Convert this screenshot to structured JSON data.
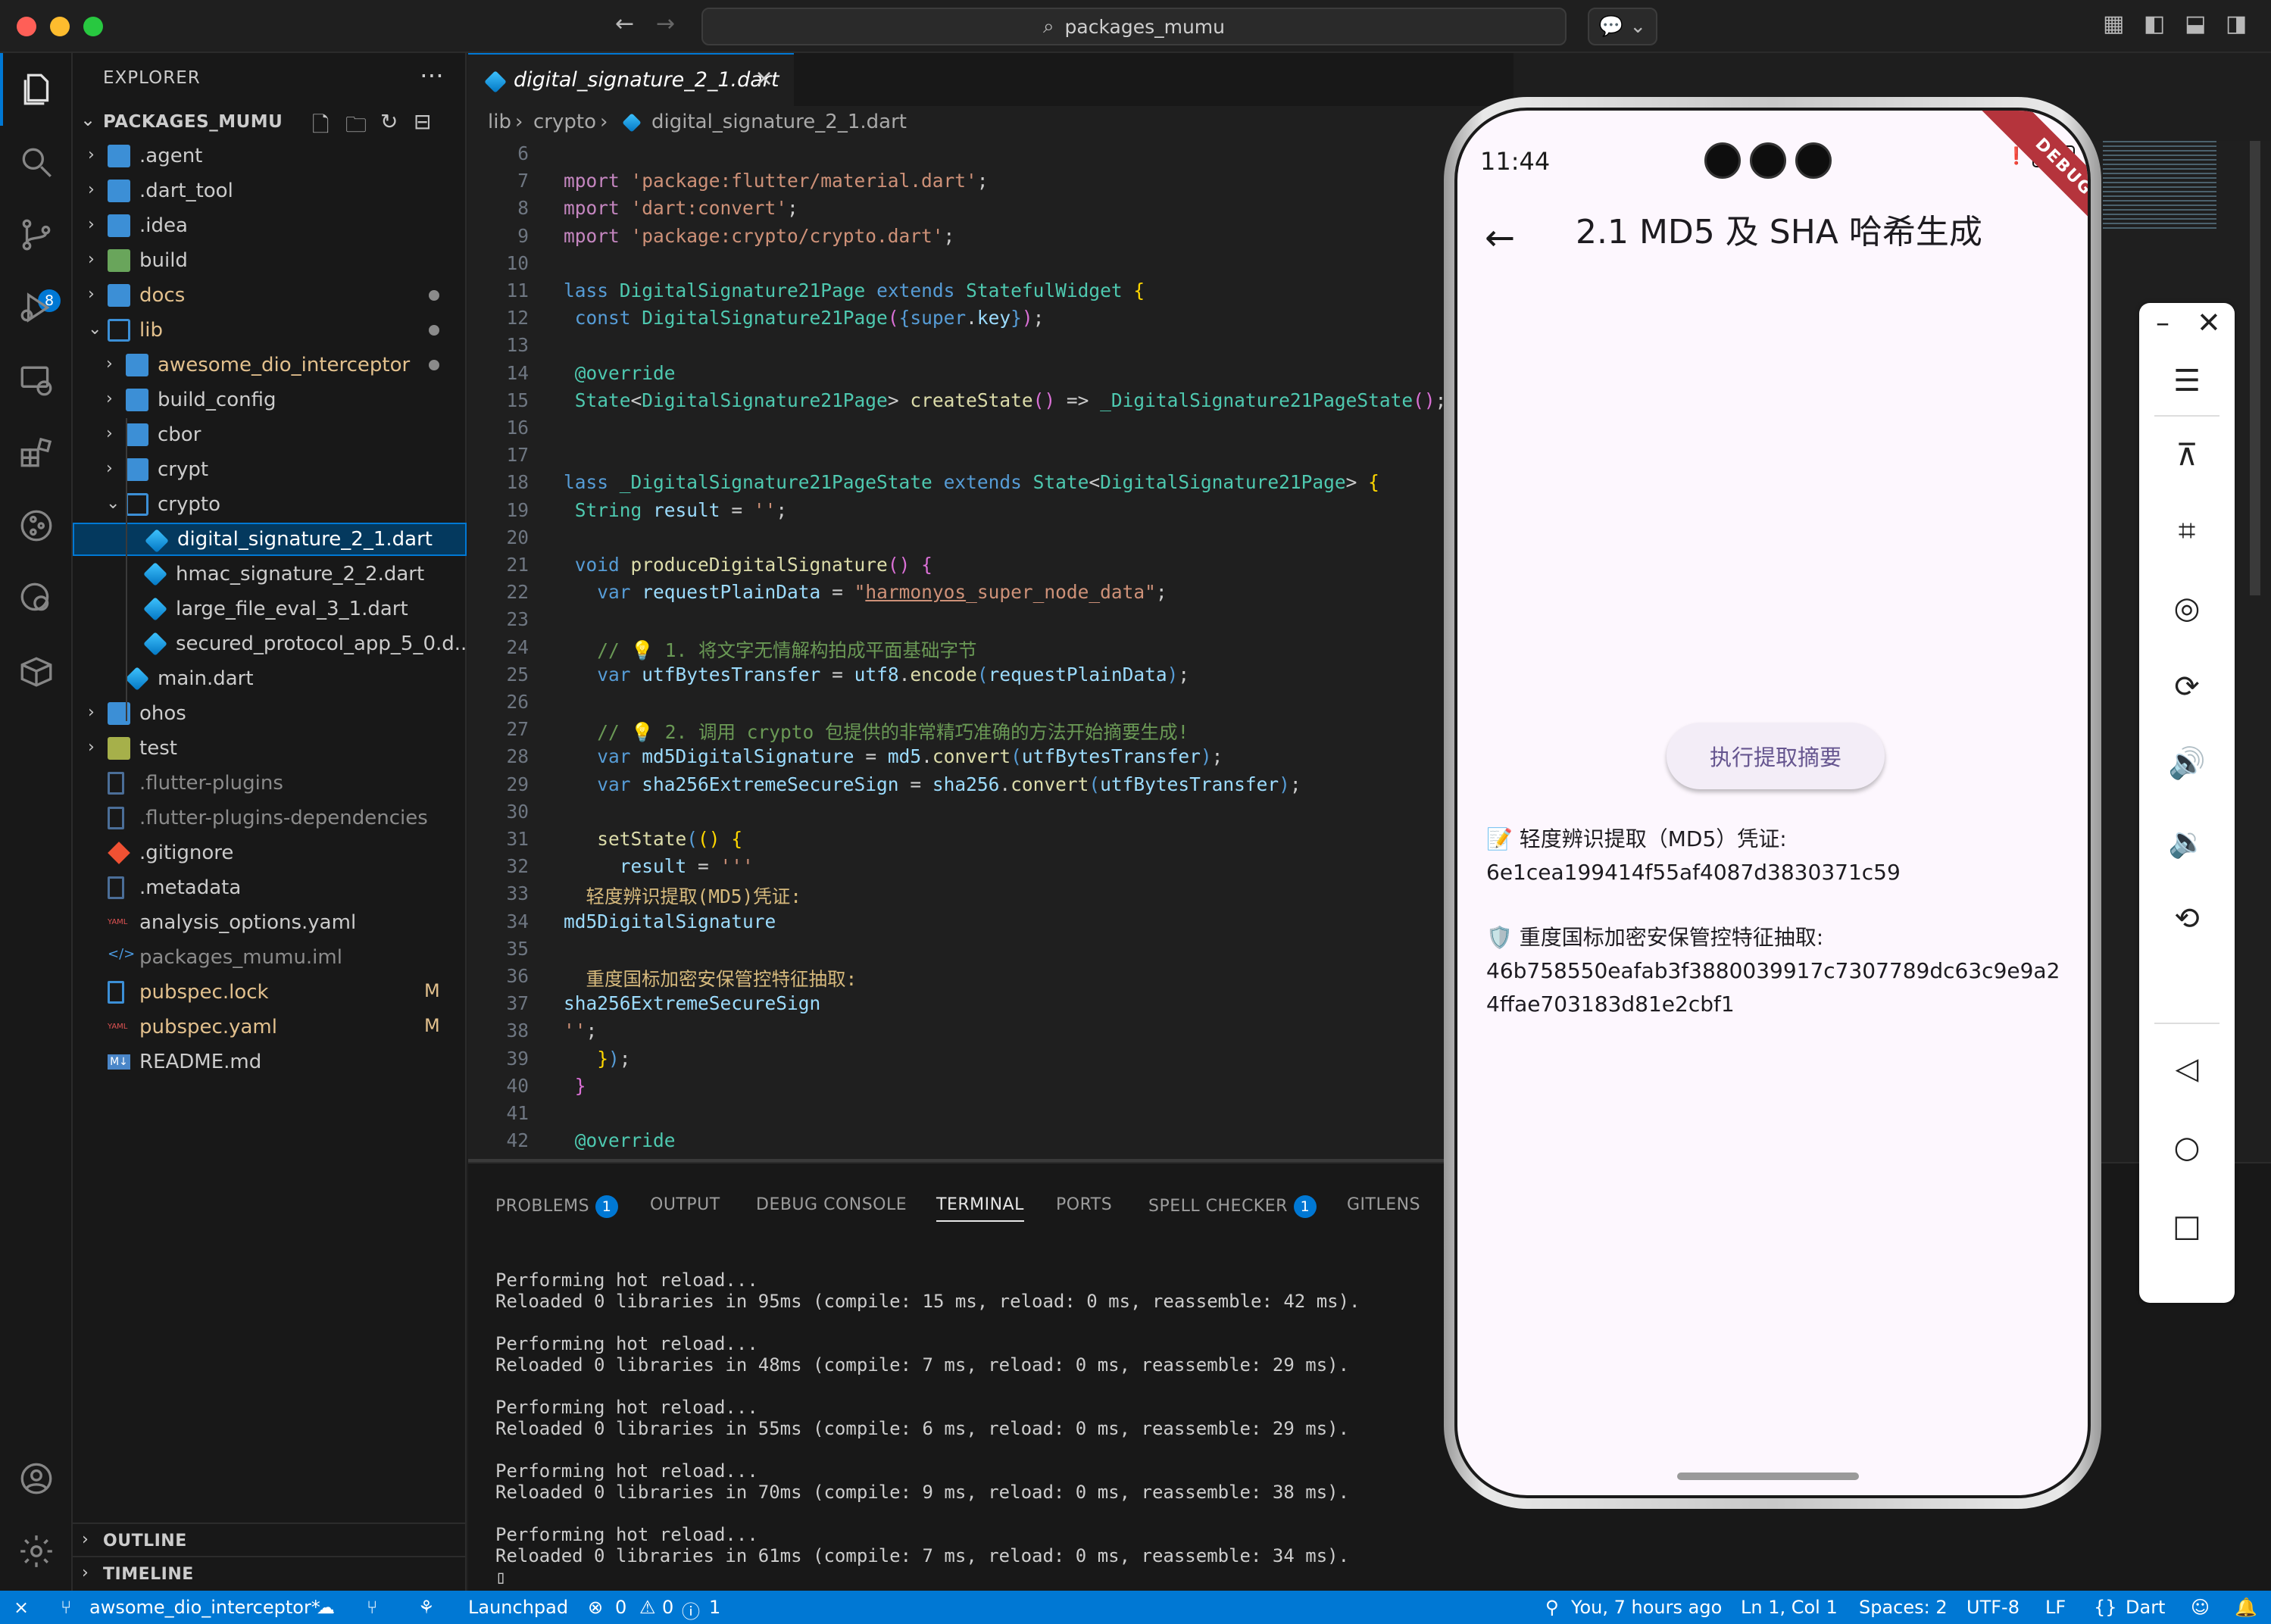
{
  "titlebar": {
    "command_center": "packages_mumu"
  },
  "activity": {
    "scm_badge": "8"
  },
  "explorer": {
    "title": "EXPLORER",
    "project": "PACKAGES_MUMU",
    "tree": [
      {
        "label": ".agent",
        "depth": 0,
        "kind": "folder",
        "open": false
      },
      {
        "label": ".dart_tool",
        "depth": 0,
        "kind": "folder",
        "open": false
      },
      {
        "label": ".idea",
        "depth": 0,
        "kind": "folder",
        "open": false
      },
      {
        "label": "build",
        "depth": 0,
        "kind": "folder-special",
        "open": false
      },
      {
        "label": "docs",
        "depth": 0,
        "kind": "folder",
        "open": false,
        "dot": true,
        "modified": true
      },
      {
        "label": "lib",
        "depth": 0,
        "kind": "folder",
        "open": true,
        "dot": true,
        "modified": true
      },
      {
        "label": "awesome_dio_interceptor",
        "depth": 1,
        "kind": "folder",
        "open": false,
        "dot": true,
        "modified": true
      },
      {
        "label": "build_config",
        "depth": 1,
        "kind": "folder",
        "open": false
      },
      {
        "label": "cbor",
        "depth": 1,
        "kind": "folder",
        "open": false
      },
      {
        "label": "crypt",
        "depth": 1,
        "kind": "folder",
        "open": false
      },
      {
        "label": "crypto",
        "depth": 1,
        "kind": "folder",
        "open": true
      },
      {
        "label": "digital_signature_2_1.dart",
        "depth": 2,
        "kind": "dart",
        "selected": true
      },
      {
        "label": "hmac_signature_2_2.dart",
        "depth": 2,
        "kind": "dart"
      },
      {
        "label": "large_file_eval_3_1.dart",
        "depth": 2,
        "kind": "dart"
      },
      {
        "label": "secured_protocol_app_5_0.d...",
        "depth": 2,
        "kind": "dart"
      },
      {
        "label": "main.dart",
        "depth": 1,
        "kind": "dart"
      },
      {
        "label": "ohos",
        "depth": 0,
        "kind": "folder",
        "open": false
      },
      {
        "label": "test",
        "depth": 0,
        "kind": "folder-test",
        "open": false
      },
      {
        "label": ".flutter-plugins",
        "depth": 0,
        "kind": "file",
        "faded": true
      },
      {
        "label": ".flutter-plugins-dependencies",
        "depth": 0,
        "kind": "file",
        "faded": true
      },
      {
        "label": ".gitignore",
        "depth": 0,
        "kind": "git"
      },
      {
        "label": ".metadata",
        "depth": 0,
        "kind": "file"
      },
      {
        "label": "analysis_options.yaml",
        "depth": 0,
        "kind": "yaml"
      },
      {
        "label": "packages_mumu.iml",
        "depth": 0,
        "kind": "xml",
        "faded": true
      },
      {
        "label": "pubspec.lock",
        "depth": 0,
        "kind": "file-blue",
        "modified": true,
        "badge": "M"
      },
      {
        "label": "pubspec.yaml",
        "depth": 0,
        "kind": "yaml",
        "modified": true,
        "badge": "M"
      },
      {
        "label": "README.md",
        "depth": 0,
        "kind": "md"
      }
    ],
    "outline": "OUTLINE",
    "timeline": "TIMELINE"
  },
  "editor": {
    "tab": "digital_signature_2_1.dart",
    "breadcrumb": [
      "lib",
      "crypto",
      "digital_signature_2_1.dart"
    ],
    "lines": [
      {
        "n": "6",
        "html": ""
      },
      {
        "n": "7",
        "html": "<span class='kw'>mport</span> <span class='s'>'package:flutter/material.dart'</span>;"
      },
      {
        "n": "8",
        "html": "<span class='kw'>mport</span> <span class='s'>'dart:convert'</span>;"
      },
      {
        "n": "9",
        "html": "<span class='kw'>mport</span> <span class='s'>'package:crypto/crypto.dart'</span>;"
      },
      {
        "n": "10",
        "html": ""
      },
      {
        "n": "11",
        "html": "<span class='k'>lass</span> <span class='t'>DigitalSignature21Page</span> <span class='k'>extends</span> <span class='t'>StatefulWidget</span> <span class='y'>{</span>"
      },
      {
        "n": "12",
        "html": " <span class='k'>const</span> <span class='t'>DigitalSignature21Page</span><span class='p'>(</span><span class='k'>{super</span>.<span class='v'>key</span><span class='k'>}</span><span class='p'>)</span>;"
      },
      {
        "n": "13",
        "html": ""
      },
      {
        "n": "14",
        "html": " <span class='t'>@override</span>"
      },
      {
        "n": "15",
        "html": " <span class='t'>State</span>&lt;<span class='t'>DigitalSignature21Page</span>&gt; <span class='f'>createState</span><span class='p'>()</span> =&gt; <span class='t'>_DigitalSignature21PageState</span><span class='p'>()</span>;"
      },
      {
        "n": "16",
        "html": ""
      },
      {
        "n": "17",
        "html": ""
      },
      {
        "n": "18",
        "html": "<span class='k'>lass</span> <span class='t'>_DigitalSignature21PageState</span> <span class='k'>extends</span> <span class='t'>State</span>&lt;<span class='t'>DigitalSignature21Page</span>&gt; <span class='y'>{</span>"
      },
      {
        "n": "19",
        "html": " <span class='t'>String</span> <span class='v'>result</span> = <span class='s'>''</span>;"
      },
      {
        "n": "20",
        "html": ""
      },
      {
        "n": "21",
        "html": " <span class='k'>void</span> <span class='f'>produceDigitalSignature</span><span class='p'>()</span> <span class='p'>{</span>"
      },
      {
        "n": "22",
        "html": "   <span class='k'>var</span> <span class='v'>requestPlainData</span> = <span class='s'>\"<u>harmonyos</u>_super_node_data\"</span>;"
      },
      {
        "n": "23",
        "html": ""
      },
      {
        "n": "24",
        "html": "   <span class='c'>// 💡 1. 将文字无情解构拍成平面基础字节</span>"
      },
      {
        "n": "25",
        "html": "   <span class='k'>var</span> <span class='v'>utfBytesTransfer</span> = <span class='v'>utf8</span>.<span class='f'>encode</span><span class='k'>(</span><span class='v'>requestPlainData</span><span class='k'>)</span>;"
      },
      {
        "n": "26",
        "html": ""
      },
      {
        "n": "27",
        "html": "   <span class='c'>// 💡 2. 调用 crypto 包提供的非常精巧准确的方法开始摘要生成!</span>"
      },
      {
        "n": "28",
        "html": "   <span class='k'>var</span> <span class='v'>md5DigitalSignature</span> = <span class='v'>md5</span>.<span class='f'>convert</span><span class='k'>(</span><span class='v'>utfBytesTransfer</span><span class='k'>)</span>;"
      },
      {
        "n": "29",
        "html": "   <span class='k'>var</span> <span class='v'>sha256ExtremeSecureSign</span> = <span class='v'>sha256</span>.<span class='f'>convert</span><span class='k'>(</span><span class='v'>utfBytesTransfer</span><span class='k'>)</span>;"
      },
      {
        "n": "30",
        "html": ""
      },
      {
        "n": "31",
        "html": "   <span class='f'>setState</span><span class='k'>(</span><span class='y'>()</span> <span class='y'>{</span>"
      },
      {
        "n": "32",
        "html": "     <span class='v'>result</span> = <span class='s'>'''</span>"
      },
      {
        "n": "33",
        "html": "  <span class='o'>轻度辨识提取(MD5)凭证:</span>"
      },
      {
        "n": "34",
        "html": "<span class='v'>md5DigitalSignature</span>"
      },
      {
        "n": "35",
        "html": ""
      },
      {
        "n": "36",
        "html": "  <span class='o'>重度国标加密安保管控特征抽取:</span>"
      },
      {
        "n": "37",
        "html": "<span class='v'>sha256ExtremeSecureSign</span>"
      },
      {
        "n": "38",
        "html": "<span class='s'>''</span>;"
      },
      {
        "n": "39",
        "html": "   <span class='y'>}</span><span class='k'>)</span>;"
      },
      {
        "n": "40",
        "html": " <span class='p'>}</span>"
      },
      {
        "n": "41",
        "html": ""
      },
      {
        "n": "42",
        "html": " <span class='t'>@override</span>"
      },
      {
        "n": "43",
        "html": " <span class='t'>Widget</span> <span class='f'>build</span><span class='p'>(</span><span class='t'>BuildContext</span> <span class='v'>context</span><span class='p'>)</span> <span class='p'>{</span>"
      }
    ]
  },
  "panel": {
    "tabs": [
      {
        "label": "PROBLEMS",
        "badge": "1"
      },
      {
        "label": "OUTPUT"
      },
      {
        "label": "DEBUG CONSOLE"
      },
      {
        "label": "TERMINAL",
        "active": true
      },
      {
        "label": "PORTS"
      },
      {
        "label": "SPELL CHECKER",
        "badge": "1"
      },
      {
        "label": "GITLENS"
      }
    ],
    "terminal": "Performing hot reload...\nReloaded 0 libraries in 95ms (compile: 15 ms, reload: 0 ms, reassemble: 42 ms).\n\nPerforming hot reload...\nReloaded 0 libraries in 48ms (compile: 7 ms, reload: 0 ms, reassemble: 29 ms).\n\nPerforming hot reload...\nReloaded 0 libraries in 55ms (compile: 6 ms, reload: 0 ms, reassemble: 29 ms).\n\nPerforming hot reload...\nReloaded 0 libraries in 70ms (compile: 9 ms, reload: 0 ms, reassemble: 38 ms).\n\nPerforming hot reload...\nReloaded 0 libraries in 61ms (compile: 7 ms, reload: 0 ms, reassemble: 34 ms).\n▯"
  },
  "status": {
    "branch": "awsome_dio_interceptor*",
    "launchpad": "Launchpad",
    "errors": "0",
    "warnings": "0",
    "info": "1",
    "blame": "You, 7 hours ago",
    "position": "Ln 1, Col 1",
    "spaces": "Spaces: 2",
    "encoding": "UTF-8",
    "eol": "LF",
    "language": "Dart"
  },
  "phone": {
    "time": "11:44",
    "battery": "100",
    "debug": "DEBUG",
    "title": "2.1 MD5 及 SHA 哈希生成",
    "button": "执行提取摘要",
    "md5_label": "📝 轻度辨识提取（MD5）凭证:",
    "md5_value": "6e1cea199414f55af4087d3830371c59",
    "sha_label": "🛡️ 重度国标加密安保管控特征抽取:",
    "sha_value_1": "46b758550eafab3f3880039917c7307789dc63c9e9a2",
    "sha_value_2": "4ffae703183d81e2cbf1"
  }
}
